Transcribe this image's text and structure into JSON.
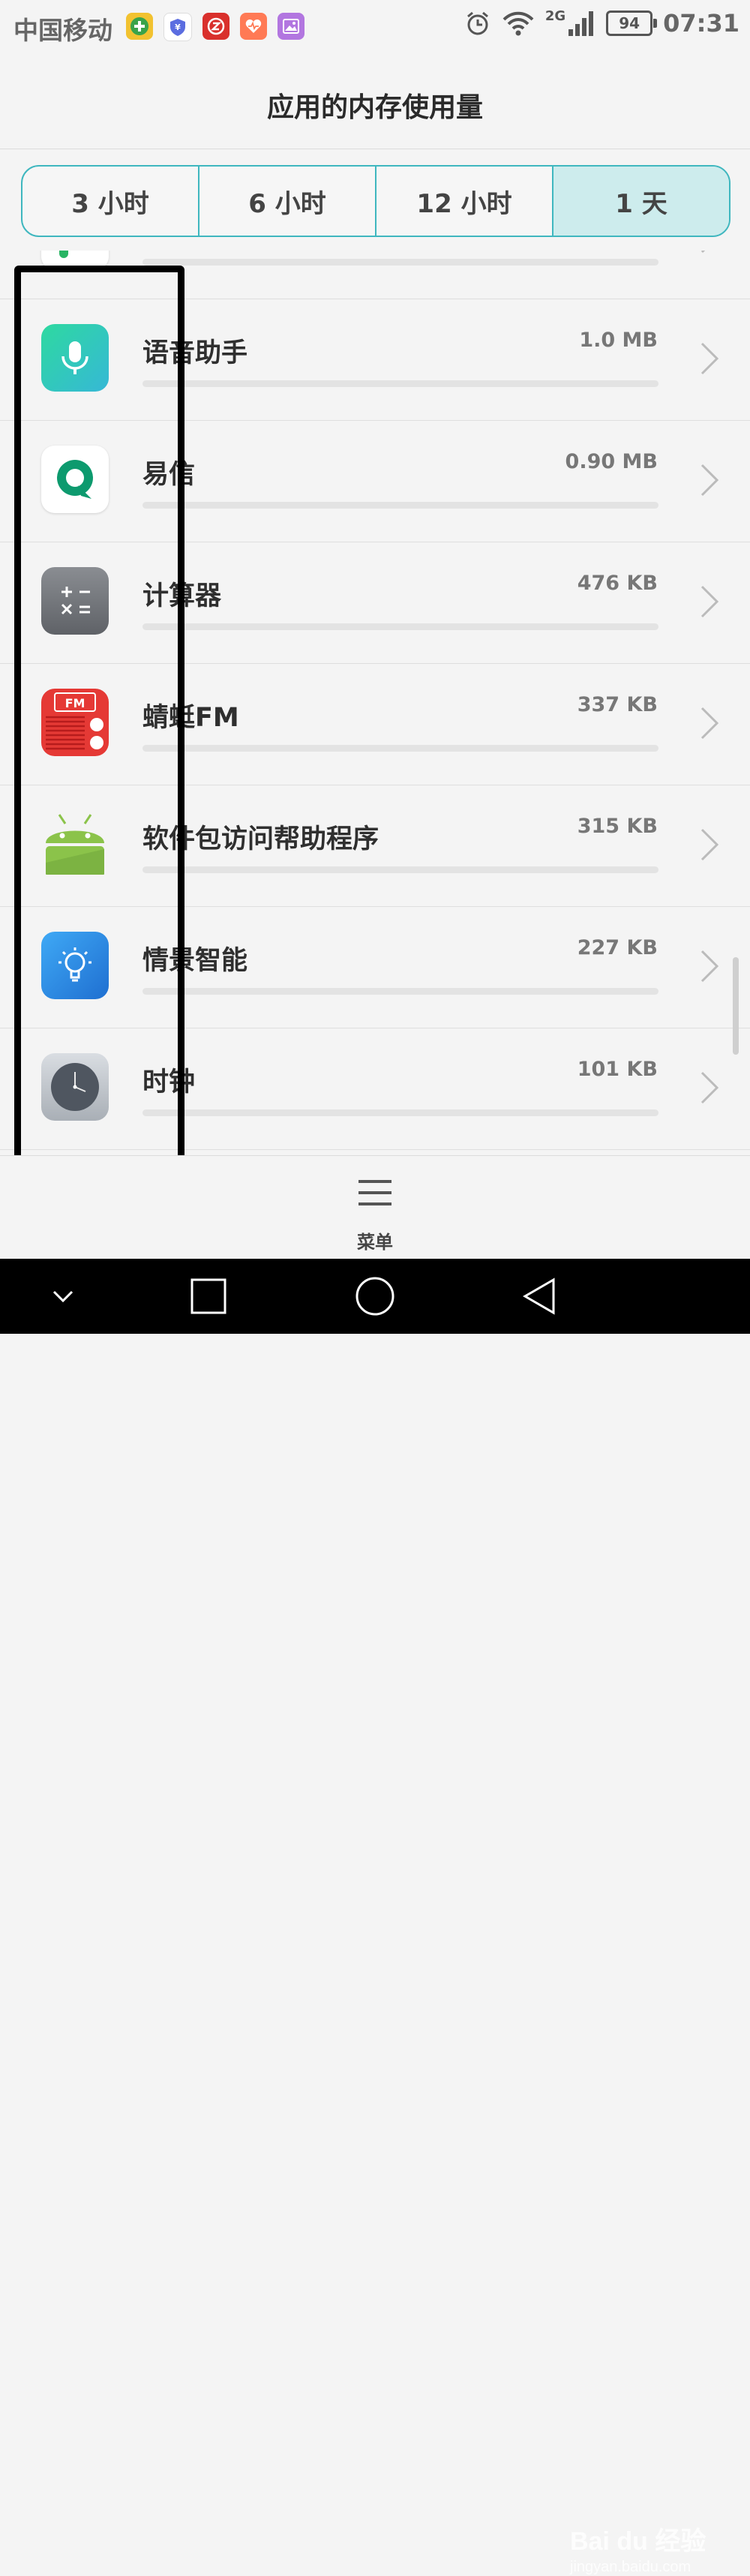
{
  "status_bar": {
    "carrier": "中国移动",
    "network": "2G",
    "battery": "94",
    "time": "07:31",
    "notification_icons": [
      "add-circle-icon",
      "shield-icon",
      "z-app-icon",
      "health-icon",
      "gallery-icon"
    ]
  },
  "header": {
    "title": "应用的内存使用量"
  },
  "tabs": [
    {
      "label": "3 小时",
      "active": false
    },
    {
      "label": "6 小时",
      "active": false
    },
    {
      "label": "12 小时",
      "active": false
    },
    {
      "label": "1 天",
      "active": true
    }
  ],
  "apps": [
    {
      "name": "",
      "size": "",
      "icon": "green-app-icon"
    },
    {
      "name": "语音助手",
      "size": "1.0 MB",
      "icon": "microphone-icon"
    },
    {
      "name": "易信",
      "size": "0.90 MB",
      "icon": "yixin-icon"
    },
    {
      "name": "计算器",
      "size": "476 KB",
      "icon": "calculator-icon"
    },
    {
      "name": "蜻蜓FM",
      "size": "337 KB",
      "icon": "radio-icon"
    },
    {
      "name": "软件包访问帮助程序",
      "size": "315 KB",
      "icon": "android-icon"
    },
    {
      "name": "情景智能",
      "size": "227 KB",
      "icon": "lightbulb-icon"
    },
    {
      "name": "时钟",
      "size": "101 KB",
      "icon": "clock-icon"
    }
  ],
  "menu": {
    "label": "菜单"
  },
  "nav": [
    "back-down-icon",
    "recents-square-icon",
    "home-circle-icon",
    "back-triangle-icon"
  ],
  "watermark": {
    "logo": "Bai du 经验",
    "url": "jingyan.baidu.com"
  }
}
